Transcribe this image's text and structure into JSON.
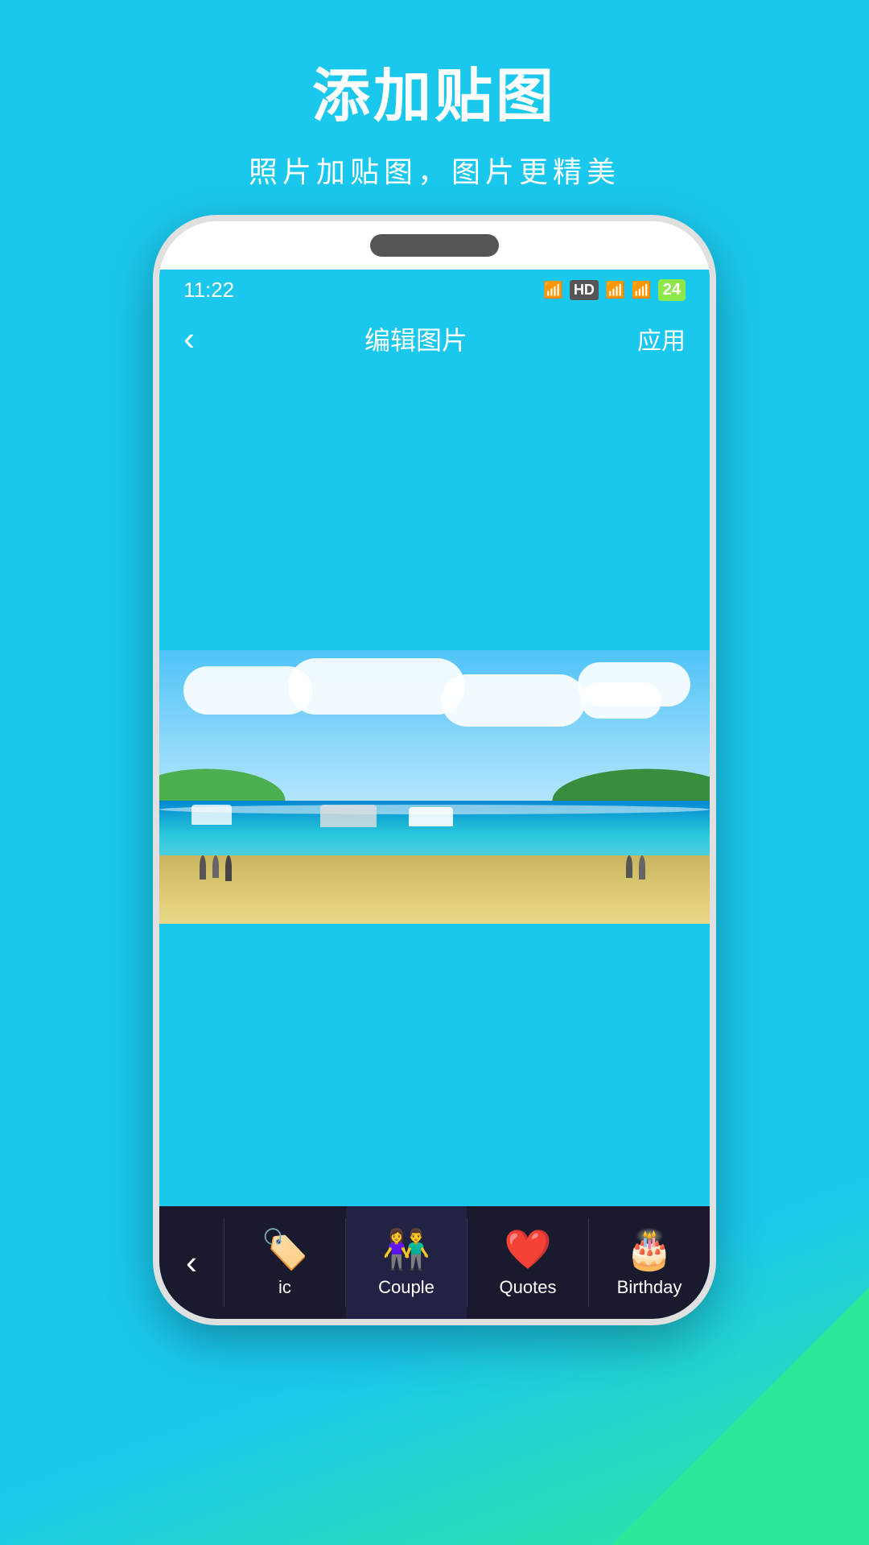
{
  "page": {
    "background_color": "#1ac8ed",
    "accent_color": "#2de89b"
  },
  "hero": {
    "main_title": "添加贴图",
    "sub_title": "照片加贴图，图片更精美"
  },
  "phone": {
    "status_bar": {
      "time": "11:22",
      "battery": "24"
    },
    "nav": {
      "back_label": "‹",
      "title": "编辑图片",
      "apply_label": "应用"
    }
  },
  "tab_bar": {
    "back_icon": "‹",
    "items": [
      {
        "id": "ic",
        "label": "ic",
        "icon": "🖼"
      },
      {
        "id": "couple",
        "label": "Couple",
        "icon": "👫"
      },
      {
        "id": "quotes",
        "label": "Quotes",
        "icon": "❤"
      },
      {
        "id": "birthday",
        "label": "Birthday",
        "icon": "🎂"
      }
    ]
  }
}
